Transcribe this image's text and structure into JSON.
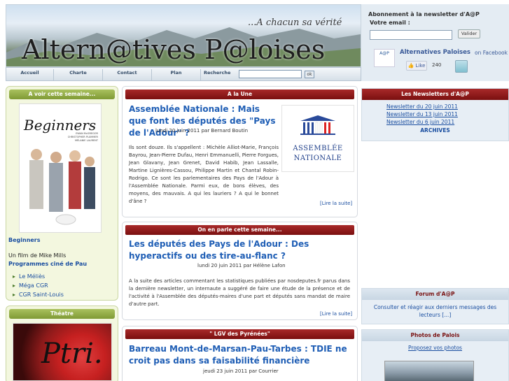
{
  "header": {
    "slogan": "...A chacun sa vérité",
    "site_title": "Altern@tives P@loises"
  },
  "nav": {
    "items": [
      "Accueil",
      "Charte",
      "Contact",
      "Plan"
    ],
    "search_label": "Recherche",
    "search_button": "ok",
    "search_value": ""
  },
  "newsletter_signup": {
    "title": "Abonnement à la newsletter d'A@P",
    "email_label": "Votre email :",
    "email_value": "",
    "submit_label": "Valider"
  },
  "facebook": {
    "logo_text": "A@P",
    "page_name": "Alternatives Paloises",
    "suffix": "on Facebook",
    "like_label": "Like",
    "like_count": "240"
  },
  "left": {
    "movie_box_title": "A voir cette semaine...",
    "poster_title": "Beginners",
    "poster_cast": "EWAN McGREGOR CHRISTOPHER PLUMMER MÉLANIE LAURENT",
    "film_title": "Beginners",
    "film_director": "Un film de Mike Mills",
    "program_link": "Programmes ciné de Pau",
    "cinemas": [
      "Le Méliès",
      "Méga CGR",
      "CGR Saint-Louis"
    ],
    "theatre_box_title": "Théatre",
    "theatre_image_text": "Ptri."
  },
  "center": {
    "sections": [
      {
        "header": "A la Une",
        "title": "Assemblée Nationale : Mais que font les députés des \"Pays de l'Adour\" ?",
        "meta": "lundi 20 juin 2011 par Bernard Boutin",
        "body": "Ils sont douze. Ils s'appellent : Michèle Alliot-Marie, François Bayrou, Jean-Pierre Dufau, Henri Emmanuelli, Pierre Forgues, Jean Glavany, Jean Grenet, David Habib, Jean Lassalle, Martine Lignières-Cassou, Philippe Martin et Chantal Robin-Rodrigo. Ce sont les parlementaires des Pays de l'Adour à l'Assemblée Nationale. Parmi eux, de bons élèves, des moyens, des mauvais. A qui les lauriers ? A qui le bonnet d'âne ?",
        "read_more": "[Lire la suite]",
        "logo_line1": "ASSEMBLÉE",
        "logo_line2": "NATIONALE"
      },
      {
        "header": "On en parle cette semaine...",
        "title": "Les députés des Pays de l'Adour : Des hyperactifs ou des tire-au-flanc ?",
        "meta": "lundi 20 juin 2011 par Hélène Lafon",
        "body": "A la suite des articles commentant les statistiques publiées par nosdeputes.fr parus dans la dernière newsletter, un internaute a suggéré de faire une étude de la présence et de l'activité à l'Assemblée des députés-maires d'une part et députés sans mandat de maire d'autre part.",
        "read_more": "[Lire la suite]"
      },
      {
        "header": "\" LGV des Pyrénées\"",
        "title": "Barreau Mont-de-Marsan-Pau-Tarbes : TDIE ne croit pas dans sa faisabilité financière",
        "meta": "jeudi 23 juin 2011 par Courrier"
      }
    ]
  },
  "right": {
    "newsletters_title": "Les Newsletters d'A@P",
    "newsletters": [
      "Newsletter du 20 juin 2011",
      "Newsletter du 13 juin 2011",
      "Newsletter du 6 juin 2011"
    ],
    "archives_label": "ARCHIVES",
    "forum_title": "Forum d'A@P",
    "forum_text": "Consulter et réagir aux derniers messages des lecteurs [...]",
    "photos_title": "Photos de Palois",
    "photos_link": "Proposez vos photos"
  },
  "colors": {
    "red_header": "#8f1c1c",
    "green_header": "#93ad48",
    "link_blue": "#1f5eb5"
  }
}
